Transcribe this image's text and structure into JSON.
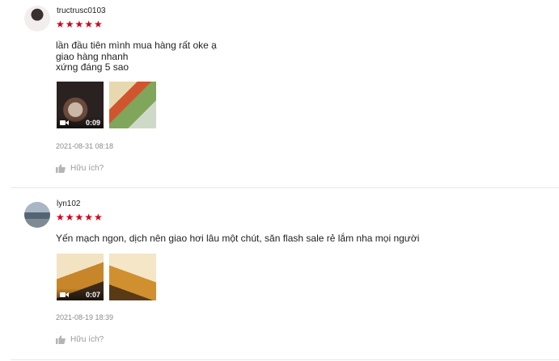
{
  "reviews": [
    {
      "username": "tructrusc0103",
      "stars": "★★★★★",
      "comment_lines": [
        "lần đầu tiên mình mua hàng rất oke ạ",
        "giao hàng nhanh",
        "xứng đáng 5 sao"
      ],
      "media": [
        {
          "type": "video",
          "duration": "0:09"
        },
        {
          "type": "image"
        }
      ],
      "timestamp": "2021-08-31 08:18",
      "helpful_label": "Hữu ích?"
    },
    {
      "username": "lyn102",
      "stars": "★★★★★",
      "comment_lines": [
        "Yến mạch ngon, dịch nên giao hơi lâu một chút, săn flash sale rẻ lắm nha mọi người"
      ],
      "media": [
        {
          "type": "video",
          "duration": "0:07"
        },
        {
          "type": "image"
        }
      ],
      "timestamp": "2021-08-19 18:39",
      "helpful_label": "Hữu ích?"
    }
  ],
  "colors": {
    "star": "#d0011b",
    "muted": "#8a8a8a"
  }
}
